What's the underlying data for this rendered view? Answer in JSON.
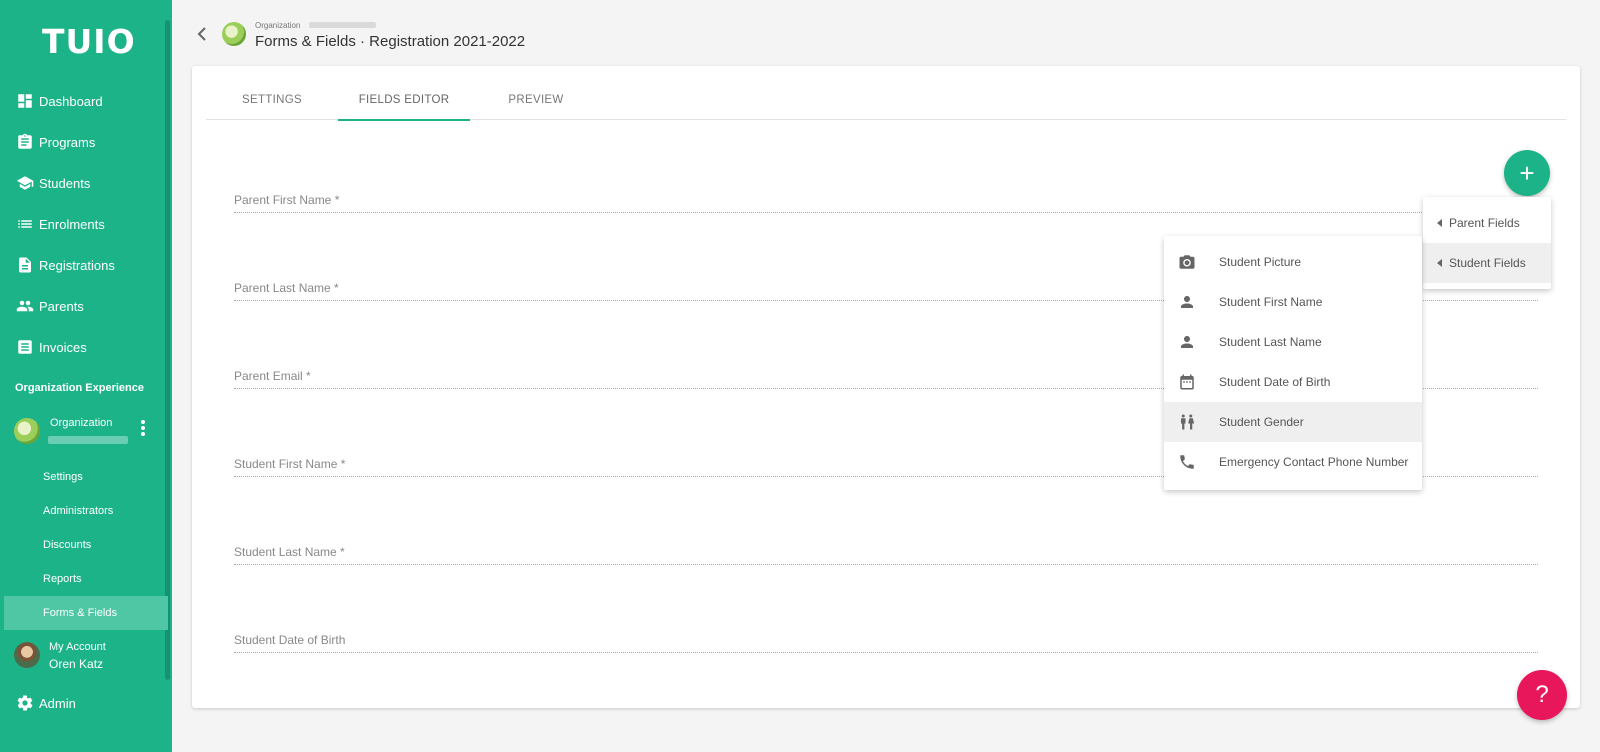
{
  "sidebar": {
    "logo": "TUIO",
    "nav": [
      {
        "label": "Dashboard",
        "icon": "dashboard-icon"
      },
      {
        "label": "Programs",
        "icon": "clipboard-icon"
      },
      {
        "label": "Students",
        "icon": "school-icon"
      },
      {
        "label": "Enrolments",
        "icon": "list-icon"
      },
      {
        "label": "Registrations",
        "icon": "document-icon"
      },
      {
        "label": "Parents",
        "icon": "people-icon"
      },
      {
        "label": "Invoices",
        "icon": "invoice-icon"
      }
    ],
    "section_label": "Organization Experience",
    "org_name": "Organization",
    "sub_items": [
      "Settings",
      "Administrators",
      "Discounts",
      "Reports",
      "Forms & Fields"
    ],
    "active_sub": "Forms & Fields",
    "account_label": "My Account",
    "account_name": "Oren Katz",
    "admin_label": "Admin"
  },
  "header": {
    "org_label": "Organization",
    "title": "Forms & Fields · Registration 2021-2022"
  },
  "tabs": [
    "SETTINGS",
    "FIELDS EDITOR",
    "PREVIEW"
  ],
  "active_tab": "FIELDS EDITOR",
  "fields": [
    "Parent First Name *",
    "Parent Last Name *",
    "Parent Email *",
    "Student First Name *",
    "Student Last Name *",
    "Student Date of Birth"
  ],
  "fab_label": "+",
  "field_groups_menu": [
    "Parent Fields",
    "Student Fields"
  ],
  "student_fields_menu": [
    {
      "label": "Student Picture",
      "icon": "camera-icon"
    },
    {
      "label": "Student First Name",
      "icon": "person-icon"
    },
    {
      "label": "Student Last Name",
      "icon": "person-icon"
    },
    {
      "label": "Student Date of Birth",
      "icon": "calendar-icon"
    },
    {
      "label": "Student Gender",
      "icon": "gender-icon"
    },
    {
      "label": "Emergency Contact Phone Number",
      "icon": "phone-icon"
    }
  ],
  "help_label": "?",
  "colors": {
    "brand": "#1db389",
    "help": "#e8165a"
  }
}
